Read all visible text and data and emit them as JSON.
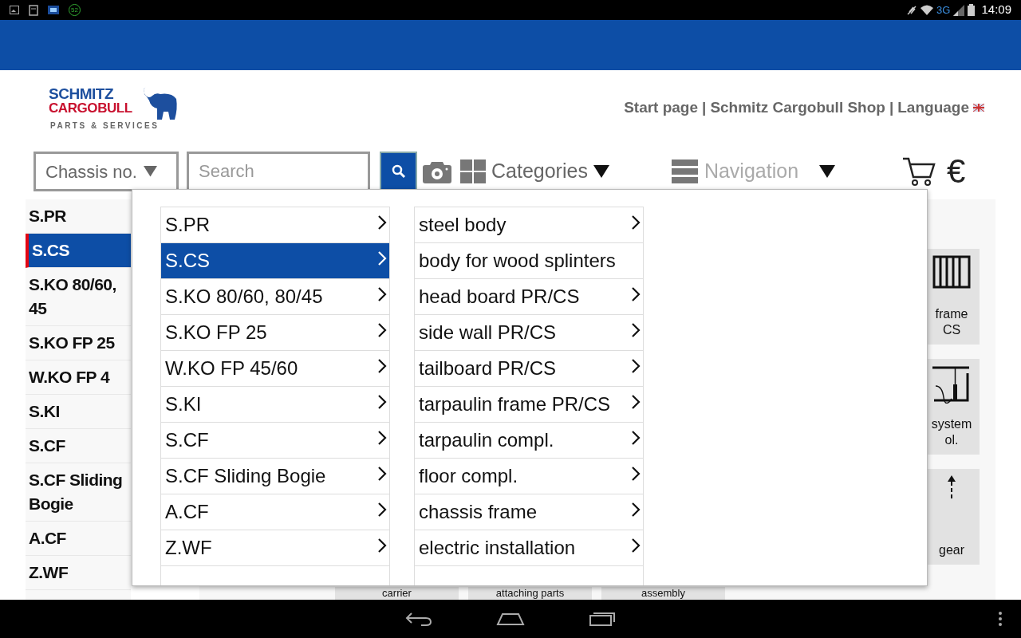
{
  "status_bar": {
    "badge": "52",
    "network": "3G",
    "time": "14:09"
  },
  "header_links": {
    "separator": "|",
    "items": [
      {
        "label": "Start page"
      },
      {
        "label": "Schmitz Cargobull Shop"
      },
      {
        "label": "Language"
      }
    ]
  },
  "logo": {
    "line_1": "SCHMITZ",
    "line_2": "CARGOBULL",
    "tagline": "PARTS & SERVICES"
  },
  "toolbar": {
    "chassis_select": "Chassis no.",
    "search": {
      "placeholder": "Search"
    },
    "categories": "Categories",
    "navigation": {
      "label": "Navigation",
      "disabled": true
    },
    "currency": "€"
  },
  "sidebar": {
    "items": [
      {
        "label": "S.PR",
        "selected": false
      },
      {
        "label": "S.CS",
        "selected": true
      },
      {
        "label": "S.KO 80/60, 45",
        "selected": false
      },
      {
        "label": "S.KO FP 25",
        "selected": false
      },
      {
        "label": "W.KO FP 4",
        "selected": false
      },
      {
        "label": "S.KI",
        "selected": false
      },
      {
        "label": "S.CF",
        "selected": false
      },
      {
        "label": "S.CF Sliding Bogie",
        "selected": false
      },
      {
        "label": "A.CF",
        "selected": false
      },
      {
        "label": "Z.WF",
        "selected": false
      }
    ]
  },
  "tiles": [
    {
      "kind": "frame",
      "label": "frame CS"
    },
    {
      "kind": "system",
      "label": "system ol."
    },
    {
      "kind": "gear",
      "label": "gear"
    }
  ],
  "bottom_tiles": [
    "carrier",
    "attaching parts",
    "assembly"
  ],
  "menu": {
    "columns": [
      {
        "items": [
          {
            "label": "S.PR",
            "selected": false,
            "has_children": true
          },
          {
            "label": "S.CS",
            "selected": true,
            "has_children": true
          },
          {
            "label": "S.KO 80/60, 80/45",
            "selected": false,
            "has_children": true
          },
          {
            "label": "S.KO FP 25",
            "selected": false,
            "has_children": true
          },
          {
            "label": "W.KO FP 45/60",
            "selected": false,
            "has_children": true
          },
          {
            "label": "S.KI",
            "selected": false,
            "has_children": true
          },
          {
            "label": "S.CF",
            "selected": false,
            "has_children": true
          },
          {
            "label": "S.CF Sliding Bogie",
            "selected": false,
            "has_children": true
          },
          {
            "label": "A.CF",
            "selected": false,
            "has_children": true
          },
          {
            "label": "Z.WF",
            "selected": false,
            "has_children": true
          }
        ]
      },
      {
        "items": [
          {
            "label": "steel body",
            "selected": false,
            "has_children": true
          },
          {
            "label": "body for wood splinters",
            "selected": false,
            "has_children": false
          },
          {
            "label": "head board PR/CS",
            "selected": false,
            "has_children": true
          },
          {
            "label": "side wall PR/CS",
            "selected": false,
            "has_children": true
          },
          {
            "label": "tailboard PR/CS",
            "selected": false,
            "has_children": true
          },
          {
            "label": "tarpaulin frame PR/CS",
            "selected": false,
            "has_children": true
          },
          {
            "label": "tarpaulin compl.",
            "selected": false,
            "has_children": true
          },
          {
            "label": "floor compl.",
            "selected": false,
            "has_children": true
          },
          {
            "label": "chassis frame",
            "selected": false,
            "has_children": true
          },
          {
            "label": "electric installation",
            "selected": false,
            "has_children": true
          }
        ]
      }
    ]
  }
}
